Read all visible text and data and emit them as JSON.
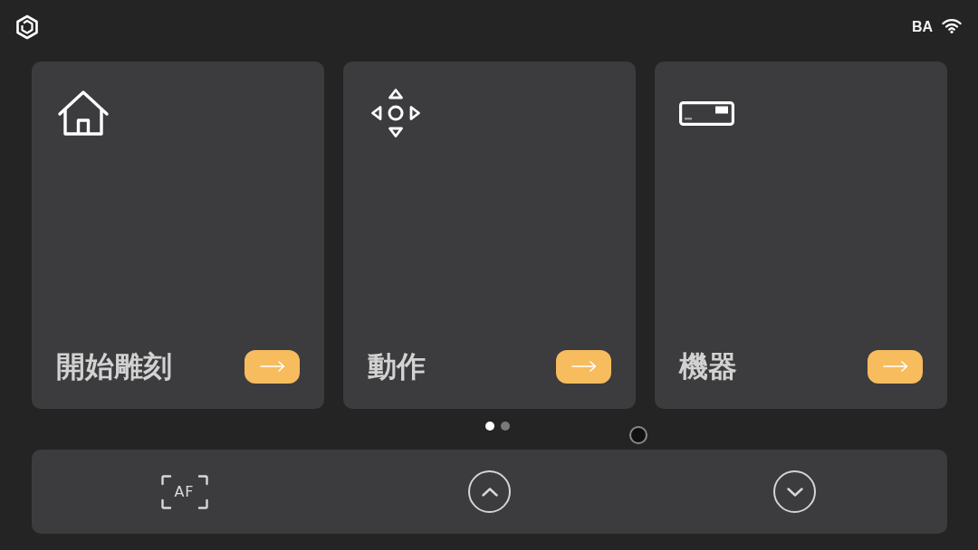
{
  "status_bar": {
    "user": "BA"
  },
  "cards": [
    {
      "title": "開始雕刻"
    },
    {
      "title": "動作"
    },
    {
      "title": "機器"
    }
  ],
  "pager": [
    {
      "selected": true
    },
    {
      "selected": false
    }
  ],
  "bottom_bar": {
    "focus_label": "AF"
  }
}
